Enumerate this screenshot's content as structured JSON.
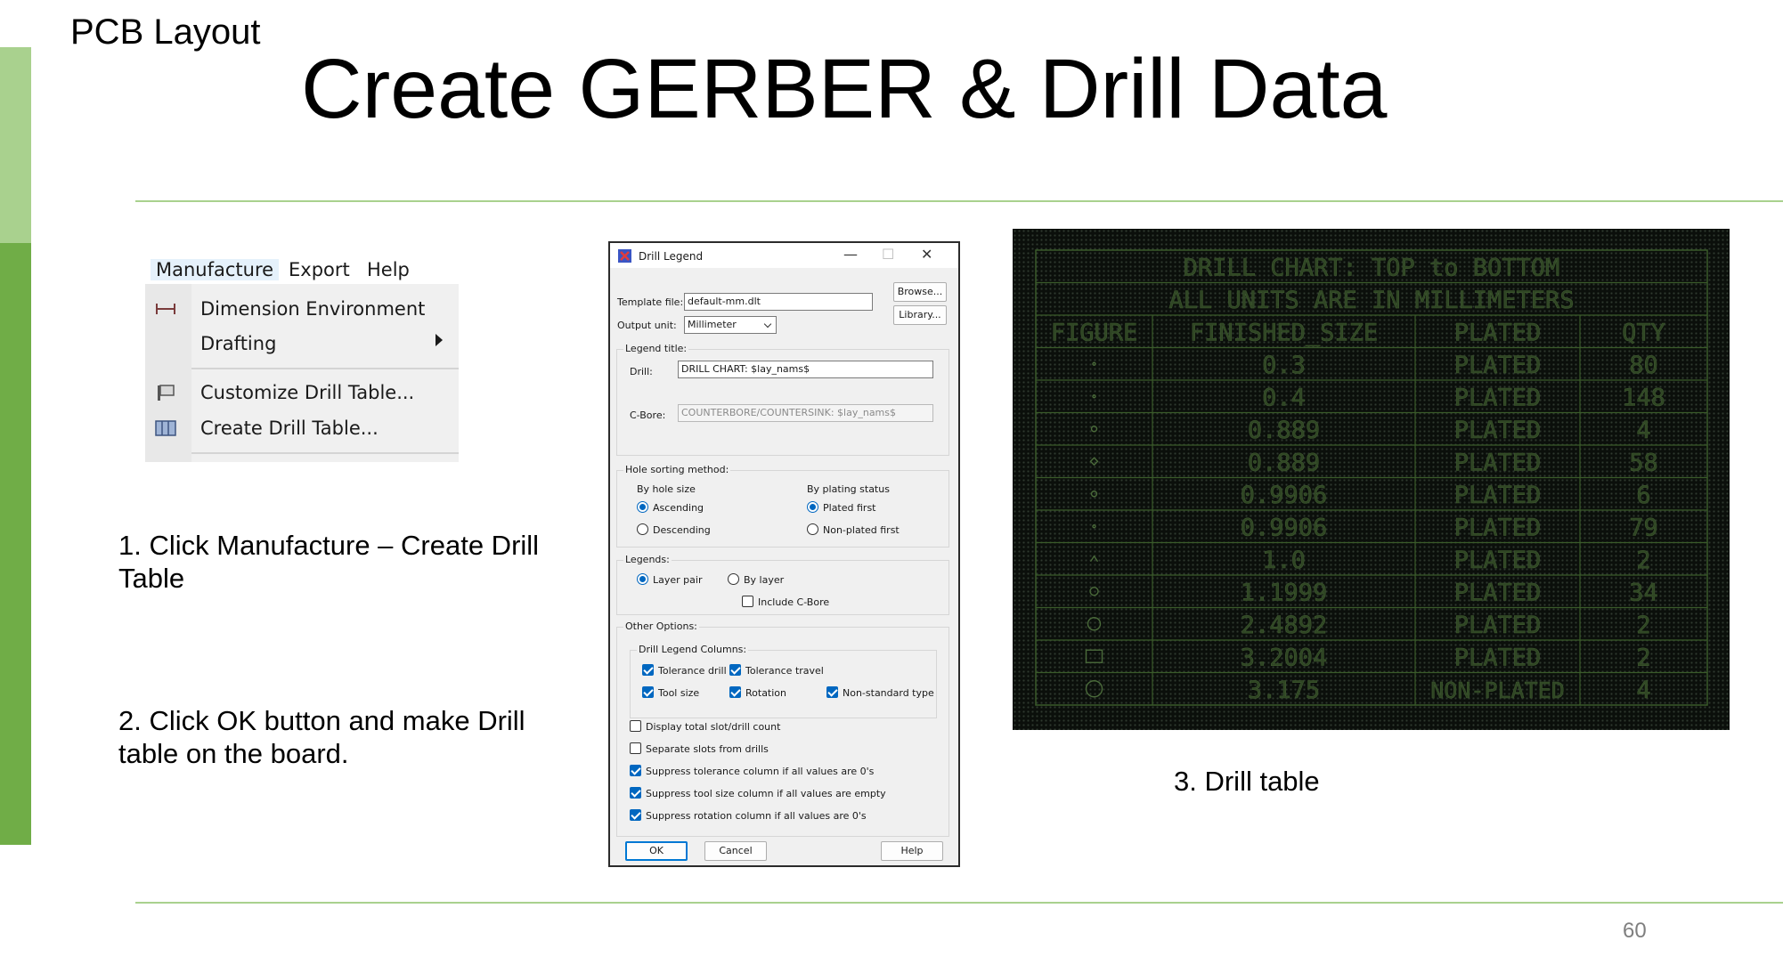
{
  "slide": {
    "label": "PCB Layout",
    "title": "Create GERBER & Drill Data",
    "page_number": "60",
    "step1": "1. Click Manufacture – Create Drill Table",
    "step2": "2. Click OK button and make Drill table on the board.",
    "step3": "3. Drill table",
    "colors": {
      "accent_light": "#a9d18e",
      "accent_dark": "#70ad47"
    }
  },
  "menu": {
    "bar": [
      "Manufacture",
      "Export",
      "Help"
    ],
    "items": [
      {
        "label": "Dimension Environment",
        "icon": "dimension-icon"
      },
      {
        "label": "Drafting",
        "icon": "",
        "submenu": true
      },
      {
        "label": "Customize Drill Table...",
        "icon": "customize-table-icon"
      },
      {
        "label": "Create Drill Table...",
        "icon": "create-table-icon"
      }
    ]
  },
  "dialog": {
    "title": "Drill Legend",
    "template_file_label": "Template file:",
    "template_file_value": "default-mm.dlt",
    "browse_button": "Browse...",
    "output_unit_label": "Output unit:",
    "output_unit_value": "Millimeter",
    "library_button": "Library...",
    "legend_title_group": "Legend title:",
    "drill_label": "Drill:",
    "drill_value": "DRILL CHART: $lay_nams$",
    "cbore_label": "C-Bore:",
    "cbore_value": "COUNTERBORE/COUNTERSINK: $lay_nams$",
    "hole_sorting_group": "Hole sorting method:",
    "by_hole_size": "By hole size",
    "ascending": "Ascending",
    "descending": "Descending",
    "by_plating_status": "By plating status",
    "plated_first": "Plated first",
    "non_plated_first": "Non-plated first",
    "legends_group": "Legends:",
    "layer_pair": "Layer pair",
    "by_layer": "By layer",
    "include_cbore": "Include C-Bore",
    "other_options_group": "Other Options:",
    "columns_group": "Drill Legend Columns:",
    "tolerance_drill": "Tolerance drill",
    "tolerance_travel": "Tolerance travel",
    "tool_size": "Tool size",
    "rotation": "Rotation",
    "non_standard_type": "Non-standard type",
    "display_total": "Display total slot/drill count",
    "separate_slots": "Separate slots from drills",
    "suppress_tolerance": "Suppress tolerance column if all values are 0's",
    "suppress_tool_size": "Suppress tool size column if all values are empty",
    "suppress_rotation": "Suppress rotation column if all values are 0's",
    "ok_button": "OK",
    "cancel_button": "Cancel",
    "help_button": "Help",
    "minimize_glyph": "—",
    "maximize_glyph": "☐",
    "close_glyph": "✕"
  },
  "drill_chart": {
    "title": "DRILL CHART: TOP to BOTTOM",
    "subtitle": "ALL UNITS ARE IN MILLIMETERS",
    "headers": [
      "FIGURE",
      "FINISHED_SIZE",
      "PLATED",
      "QTY"
    ],
    "rows": [
      {
        "figure": "dot-small",
        "size": "0.3",
        "plated": "PLATED",
        "qty": "80"
      },
      {
        "figure": "dot-small",
        "size": "0.4",
        "plated": "PLATED",
        "qty": "148"
      },
      {
        "figure": "circle-tiny",
        "size": "0.889",
        "plated": "PLATED",
        "qty": "4"
      },
      {
        "figure": "diamond-tiny",
        "size": "0.889",
        "plated": "PLATED",
        "qty": "58"
      },
      {
        "figure": "circle-tiny",
        "size": "0.9906",
        "plated": "PLATED",
        "qty": "6"
      },
      {
        "figure": "dot-small",
        "size": "0.9906",
        "plated": "PLATED",
        "qty": "79"
      },
      {
        "figure": "caret",
        "size": "1.0",
        "plated": "PLATED",
        "qty": "2"
      },
      {
        "figure": "circle-small",
        "size": "1.1999",
        "plated": "PLATED",
        "qty": "34"
      },
      {
        "figure": "circle-medium",
        "size": "2.4892",
        "plated": "PLATED",
        "qty": "2"
      },
      {
        "figure": "square",
        "size": "3.2004",
        "plated": "PLATED",
        "qty": "2"
      },
      {
        "figure": "circle-large",
        "size": "3.175",
        "plated": "NON-PLATED",
        "qty": "4"
      }
    ],
    "colors": {
      "background": "#0b0f0b",
      "lines": "#3a5a2a",
      "text": "#2f4524"
    }
  }
}
